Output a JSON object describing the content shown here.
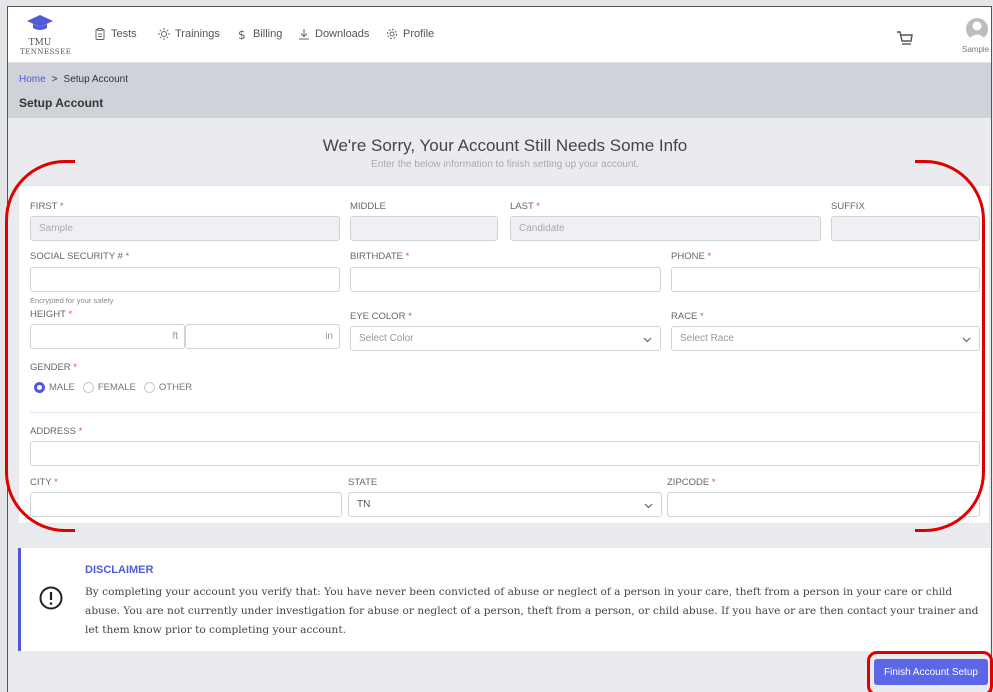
{
  "brand": {
    "line1": "TMU",
    "line2": "TENNESSEE"
  },
  "nav": [
    {
      "label": "Tests",
      "icon": "clipboard-icon"
    },
    {
      "label": "Trainings",
      "icon": "sun-icon"
    },
    {
      "label": "Billing",
      "icon": "dollar-icon"
    },
    {
      "label": "Downloads",
      "icon": "download-icon"
    },
    {
      "label": "Profile",
      "icon": "gear-icon"
    }
  ],
  "user": {
    "name": "Sample"
  },
  "breadcrumb": {
    "home": "Home",
    "separator": ">",
    "current": "Setup Account"
  },
  "page_title": "Setup Account",
  "heading": "We're Sorry, Your Account Still Needs Some Info",
  "subheading": "Enter the below information to finish setting up your account.",
  "form": {
    "first": {
      "label": "FIRST",
      "value": "Sample",
      "required": "*"
    },
    "middle": {
      "label": "MIDDLE",
      "value": ""
    },
    "last": {
      "label": "LAST",
      "value": "Candidate",
      "required": "*"
    },
    "suffix": {
      "label": "SUFFIX",
      "value": ""
    },
    "ssn": {
      "label": "SOCIAL SECURITY #",
      "required": "*",
      "help": "Encrypted for your safety"
    },
    "birthdate": {
      "label": "BIRTHDATE",
      "required": "*"
    },
    "phone": {
      "label": "PHONE",
      "required": "*"
    },
    "height": {
      "label": "HEIGHT",
      "required": "*",
      "ft": "ft",
      "in": "in"
    },
    "eye_color": {
      "label": "EYE COLOR",
      "required": "*",
      "placeholder": "Select Color"
    },
    "race": {
      "label": "RACE",
      "required": "*",
      "placeholder": "Select Race"
    },
    "gender": {
      "label": "GENDER",
      "required": "*",
      "options": [
        "MALE",
        "FEMALE",
        "OTHER"
      ],
      "selected": "MALE"
    },
    "address": {
      "label": "ADDRESS",
      "required": "*"
    },
    "city": {
      "label": "CITY",
      "required": "*"
    },
    "state": {
      "label": "STATE",
      "value": "TN"
    },
    "zipcode": {
      "label": "ZIPCODE",
      "required": "*"
    }
  },
  "disclaimer": {
    "title": "DISCLAIMER",
    "body": "By completing your account you verify that: You have never been convicted of abuse or neglect of a person in your care, theft from a person in your care or child abuse. You are not currently under investigation for abuse or neglect of a person, theft from a person, or child abuse. If you have or are then contact your trainer and let them know prior to completing your account."
  },
  "finish_button": "Finish Account Setup",
  "colors": {
    "accent": "#4f5bd5",
    "required": "#e04c4c",
    "annotation": "#e00000"
  }
}
